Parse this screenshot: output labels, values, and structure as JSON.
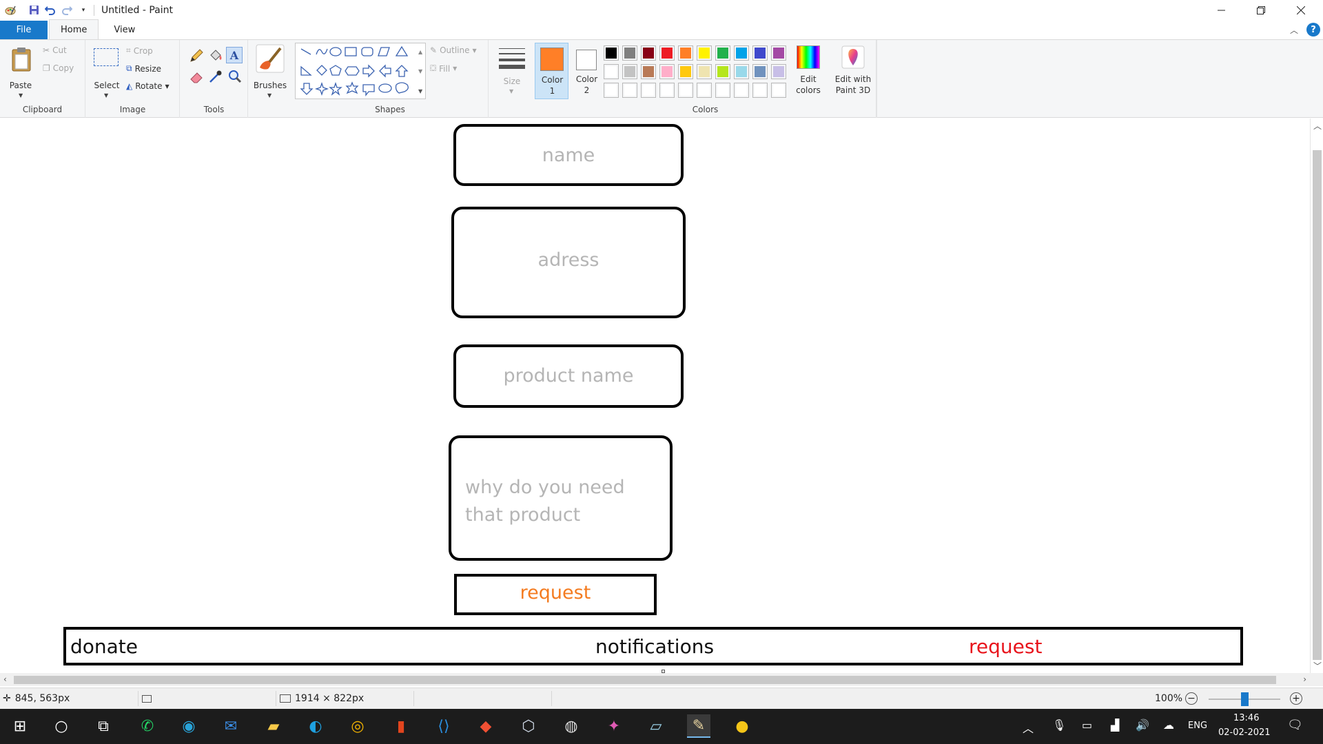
{
  "window": {
    "title": "Untitled - Paint",
    "qat_icons": [
      "paint-app-icon",
      "save-icon",
      "undo-icon",
      "redo-icon",
      "customize-dropdown-icon"
    ]
  },
  "tabs": [
    "File",
    "Home",
    "View"
  ],
  "ribbon": {
    "clipboard": {
      "label": "Clipboard",
      "paste": "Paste",
      "cut": "Cut",
      "copy": "Copy"
    },
    "image": {
      "label": "Image",
      "select": "Select",
      "crop": "Crop",
      "resize": "Resize",
      "rotate": "Rotate"
    },
    "tools": {
      "label": "Tools"
    },
    "brushes": {
      "label": "Brushes"
    },
    "shapes": {
      "label": "Shapes",
      "outline": "Outline",
      "fill": "Fill"
    },
    "size": {
      "label": "Size"
    },
    "colors": {
      "label": "Colors",
      "color1": "Color\n1",
      "color2": "Color\n2",
      "color1_value": "#ff7f27",
      "color2_value": "#ffffff",
      "edit_colors": "Edit\ncolors",
      "palette_row1": [
        "#000000",
        "#7f7f7f",
        "#880015",
        "#ed1c24",
        "#ff7f27",
        "#fff200",
        "#22b14c",
        "#00a2e8",
        "#3f48cc",
        "#a349a4"
      ],
      "palette_row2": [
        "#ffffff",
        "#c3c3c3",
        "#b97a57",
        "#ffaec9",
        "#ffc90e",
        "#efe4b0",
        "#b5e61d",
        "#99d9ea",
        "#7092be",
        "#c8bfe7"
      ],
      "palette_row3": [
        "#ffffff",
        "#ffffff",
        "#ffffff",
        "#ffffff",
        "#ffffff",
        "#ffffff",
        "#ffffff",
        "#ffffff",
        "#ffffff",
        "#ffffff"
      ]
    },
    "paint3d": {
      "label": "Edit with\nPaint 3D"
    }
  },
  "canvas": {
    "field_name": "name",
    "field_address": "adress",
    "field_product": "product name",
    "field_reason": "why do you need that product",
    "request_button": "request",
    "nav_donate": "donate",
    "nav_notifications": "notifications",
    "nav_request": "request",
    "colors": {
      "orange": "#f47b20",
      "red": "#e8141c",
      "placeholder": "#b5b5b5"
    }
  },
  "statusbar": {
    "cursor_pos": "845, 563px",
    "canvas_size": "1914 × 822px",
    "zoom": "100%",
    "zoom_level": 1.0
  },
  "taskbar": {
    "apps": [
      "windows-start-icon",
      "search-circle-icon",
      "task-view-icon",
      "whatsapp-icon",
      "app-blue-icon",
      "mail-icon",
      "file-explorer-icon",
      "edge-icon",
      "chrome-icon",
      "office-icon",
      "vscode-icon",
      "git-icon",
      "package-icon",
      "pen-app-icon",
      "photos-app-icon",
      "notebook-icon",
      "paint-icon",
      "emoji-app-icon"
    ],
    "lang": "ENG",
    "time": "13:46",
    "date": "02-02-2021"
  }
}
